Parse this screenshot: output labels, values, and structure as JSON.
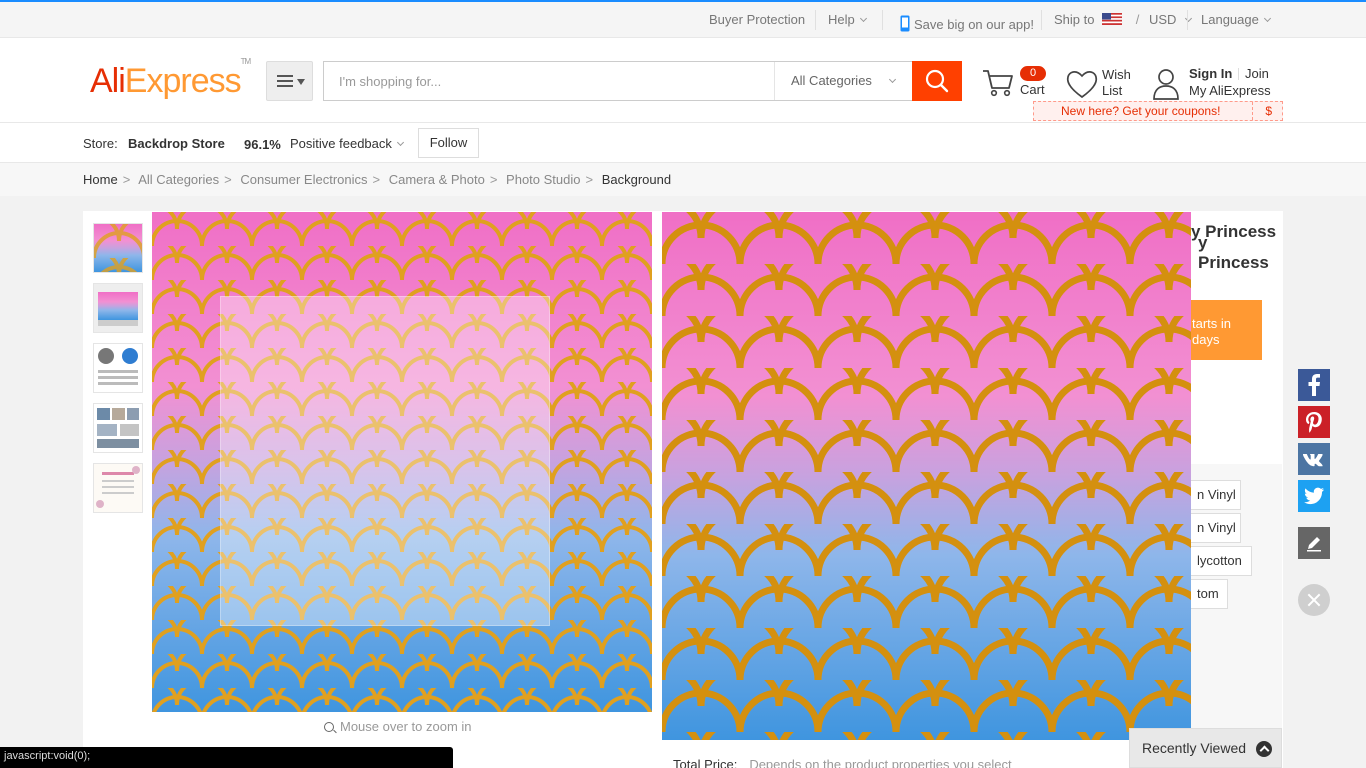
{
  "topbar": {
    "buyer_protection": "Buyer Protection",
    "help": "Help",
    "app": "Save big on our app!",
    "ship_to": "Ship to",
    "currency": "USD",
    "language": "Language"
  },
  "header": {
    "logo": "AliExpress",
    "search_placeholder": "I'm shopping for...",
    "category": "All Categories",
    "cart_count": "0",
    "cart_label": "Cart",
    "wish_label": "Wish List",
    "sign_in": "Sign In",
    "join": "Join",
    "my_aliexpress": "My AliExpress",
    "coupon_text": "New here? Get your coupons!",
    "coupon_symbol": "$"
  },
  "store": {
    "label": "Store:",
    "name": "Backdrop Store",
    "feedback_pct": "96.1%",
    "feedback_label": "Positive feedback",
    "follow": "Follow"
  },
  "breadcrumb": [
    "Home",
    "All Categories",
    "Consumer Electronics",
    "Camera & Photo",
    "Photo Studio",
    "Background"
  ],
  "product": {
    "title_fragment": "y Princess",
    "promo_line1": "tarts in",
    "promo_line2": "days",
    "materials": [
      "n Vinyl",
      "n Vinyl",
      "lycotton",
      "tom"
    ],
    "zoom_hint": "Mouse over to zoom in",
    "total_price_label": "Total Price:",
    "total_price_hint": "Depends on the product properties you select"
  },
  "sidebar": {
    "recently_viewed": "Recently Viewed"
  },
  "status": "javascript:void(0);",
  "colors": {
    "brand": "#e62e04",
    "search_button": "#ff4000",
    "promo": "#ff9933"
  }
}
